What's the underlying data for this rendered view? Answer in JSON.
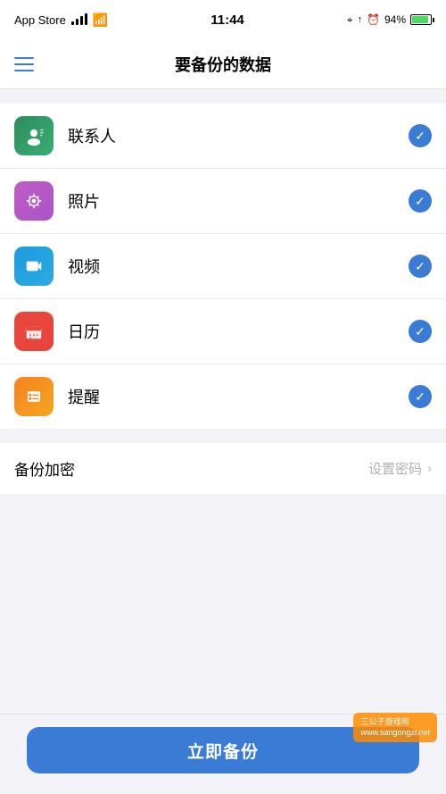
{
  "statusBar": {
    "appStore": "App Store",
    "signal": "●●●",
    "time": "11:44",
    "battery": "94%",
    "batteryIcon": "🔋",
    "gps": "↑",
    "alarm": "⏰"
  },
  "navBar": {
    "title": "要备份的数据",
    "menuIcon": "≡"
  },
  "items": [
    {
      "id": "contacts",
      "label": "联系人",
      "iconClass": "icon-contacts",
      "checked": true
    },
    {
      "id": "photos",
      "label": "照片",
      "iconClass": "icon-photos",
      "checked": true
    },
    {
      "id": "videos",
      "label": "视频",
      "iconClass": "icon-videos",
      "checked": true
    },
    {
      "id": "calendar",
      "label": "日历",
      "iconClass": "icon-calendar",
      "checked": true
    },
    {
      "id": "reminders",
      "label": "提醒",
      "iconClass": "icon-reminders",
      "checked": true
    }
  ],
  "encryption": {
    "label": "备份加密",
    "action": "设置密码",
    "chevron": "›"
  },
  "backupButton": {
    "label": "立即备份"
  },
  "watermark": {
    "text": "三公子游戏网\nwww.sangongzi.net"
  }
}
